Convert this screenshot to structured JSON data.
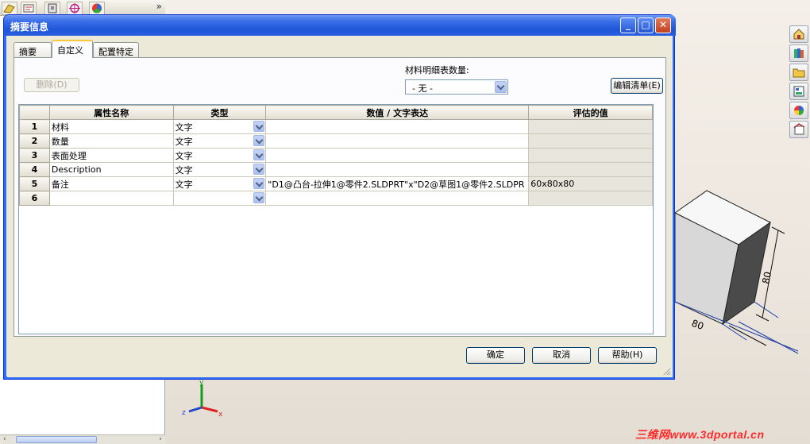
{
  "dialog": {
    "title": "摘要信息",
    "tabs": [
      {
        "label": "摘要"
      },
      {
        "label": "自定义"
      },
      {
        "label": "配置特定"
      }
    ],
    "delete_label": "删除(D)",
    "bom_quantity_label": "材料明细表数量:",
    "bom_quantity_value": "- 无 -",
    "edit_list_label": "编辑清单(E)",
    "ok_label": "确定",
    "cancel_label": "取消",
    "help_label": "帮助(H)",
    "window_buttons": {
      "minimize": "_",
      "maximize": "□",
      "close": "✕"
    }
  },
  "grid": {
    "columns": [
      "属性名称",
      "类型",
      "数值 / 文字表达",
      "评估的值"
    ],
    "rows": [
      {
        "num": "1",
        "name": "材料",
        "type": "文字",
        "value": "",
        "evaluated": ""
      },
      {
        "num": "2",
        "name": "数量",
        "type": "文字",
        "value": "",
        "evaluated": ""
      },
      {
        "num": "3",
        "name": "表面处理",
        "type": "文字",
        "value": "",
        "evaluated": ""
      },
      {
        "num": "4",
        "name": "Description",
        "type": "文字",
        "value": "",
        "evaluated": ""
      },
      {
        "num": "5",
        "name": "备注",
        "type": "文字",
        "value": "\"D1@凸台-拉伸1@零件2.SLDPRT\"x\"D2@草图1@零件2.SLDPR",
        "evaluated": "60x80x80"
      },
      {
        "num": "6",
        "name": "",
        "type": "",
        "value": "",
        "evaluated": ""
      }
    ]
  },
  "model": {
    "dim_width": "80",
    "dim_height": "80",
    "dim_depth": "80"
  },
  "triad": {
    "x": "x",
    "y": "y",
    "z": "z"
  },
  "watermark": "三维网www.3dportal.cn",
  "fm_panel": {
    "overflow": "»"
  },
  "colors": {
    "title_bar": "#2a5fe0",
    "dialog_bg": "#ece9d8",
    "tab_active_border": "#ffc83c",
    "watermark": "#ff2a2a"
  }
}
